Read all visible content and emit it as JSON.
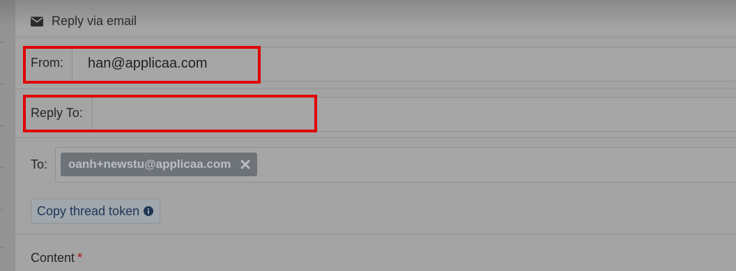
{
  "header": {
    "icon": "envelope-icon",
    "title": "Reply via email"
  },
  "from": {
    "label": "From:",
    "value": "han@applicaa.com"
  },
  "reply_to": {
    "label": "Reply To:",
    "value": ""
  },
  "to": {
    "label": "To:",
    "recipients": [
      {
        "email": "oanh+newstu@applicaa.com",
        "remove_icon": "close-icon"
      }
    ]
  },
  "copy_thread": {
    "label": "Copy thread token",
    "icon": "info-icon"
  },
  "content": {
    "label": "Content",
    "required_mark": "*"
  },
  "colors": {
    "highlight": "#e00000",
    "chip_bg": "#6e7378",
    "button_text": "#1f3555"
  }
}
